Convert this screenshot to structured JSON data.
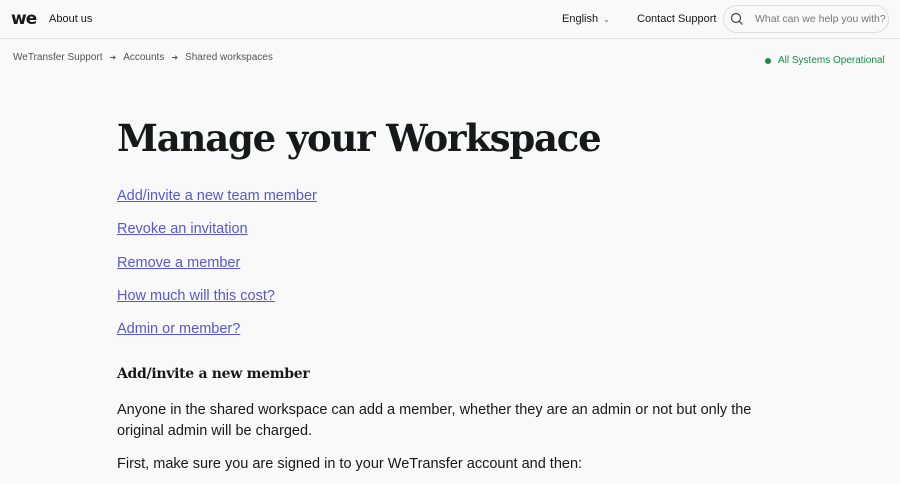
{
  "header": {
    "logo": "we",
    "about": "About us",
    "language": "English",
    "contact": "Contact Support",
    "search_placeholder": "What can we help you with?"
  },
  "breadcrumb": [
    "WeTransfer Support",
    "Accounts",
    "Shared workspaces"
  ],
  "status": {
    "text": "All Systems Operational",
    "color": "#1d8a4a"
  },
  "article": {
    "title": "Manage your Workspace",
    "links": [
      "Add/invite a new team member",
      "Revoke an invitation",
      "Remove a member",
      "How much will this cost?",
      "Admin or member?"
    ],
    "section_heading": "Add/invite a new member",
    "paragraphs": [
      "Anyone in the shared workspace can add a member, whether they are an admin or not but only the original admin will be charged.",
      "First, make sure you are signed in to your WeTransfer account and then:"
    ]
  }
}
